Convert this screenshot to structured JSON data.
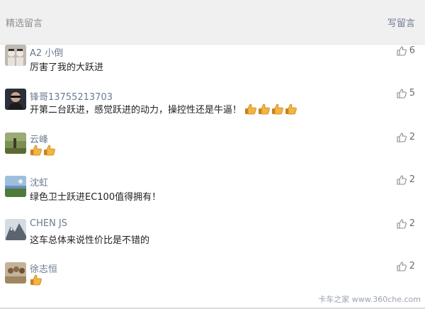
{
  "header": {
    "title": "精选留言",
    "write_label": "写留言"
  },
  "comments": [
    {
      "name": "A2 小倒",
      "text": "厉害了我的大跃进",
      "likes": "6",
      "emoji_count": 0
    },
    {
      "name": "锋哥13755213703",
      "text": "开第二台跃进，感觉跃进的动力，操控性还是牛逼！",
      "likes": "5",
      "emoji_count": 4
    },
    {
      "name": "云峰",
      "text": "",
      "likes": "2",
      "emoji_count": 2
    },
    {
      "name": "沈虹",
      "text": "绿色卫士跃进EC100值得拥有！",
      "likes": "2",
      "emoji_count": 0
    },
    {
      "name": "CHEN JS",
      "text": "这车总体来说性价比是不错的",
      "likes": "2",
      "emoji_count": 0
    },
    {
      "name": "徐志恒",
      "text": "",
      "likes": "2",
      "emoji_count": 1
    }
  ],
  "watermark": "卡车之家 www.360che.com",
  "colors": {
    "header_bg": "#f0f0f0",
    "name": "#6b7a8f",
    "link": "#707b96"
  },
  "icons": {
    "like": "thumb-up-outline-icon",
    "emoji": "thumbs-up-emoji-icon"
  }
}
